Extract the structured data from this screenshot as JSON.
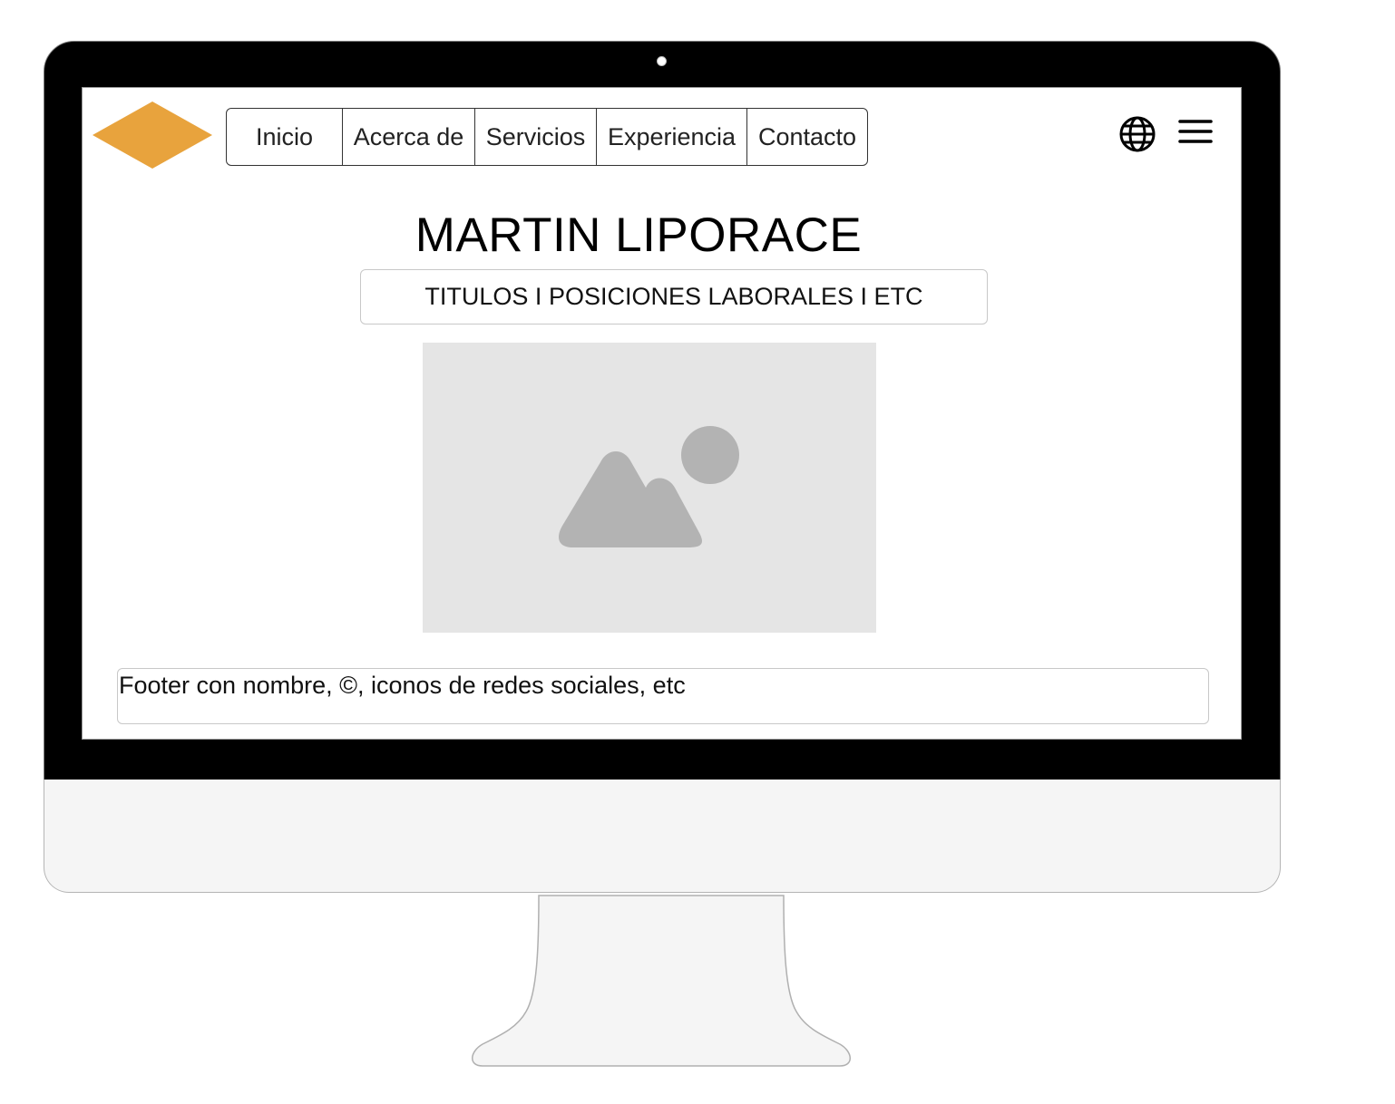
{
  "nav": {
    "items": [
      {
        "label": "Inicio"
      },
      {
        "label": "Acerca de"
      },
      {
        "label": "Servicios"
      },
      {
        "label": "Experiencia"
      },
      {
        "label": "Contacto"
      }
    ]
  },
  "icons": {
    "logo": "diamond-logo",
    "language": "globe-icon",
    "menu": "hamburger-menu-icon",
    "image_placeholder": "image-icon"
  },
  "hero": {
    "title": "MARTIN LIPORACE",
    "subtitle": "TITULOS I POSICIONES LABORALES I ETC"
  },
  "footer": {
    "text": "Footer con nombre, ©, iconos de redes sociales, etc"
  },
  "colors": {
    "logo_accent": "#E8A33D",
    "monitor_bezel": "#000000",
    "monitor_chin": "#F5F5F5",
    "image_placeholder_bg": "#E5E5E5",
    "image_placeholder_fg": "#B3B3B3"
  }
}
